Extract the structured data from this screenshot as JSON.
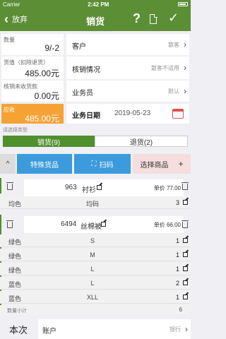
{
  "status": {
    "carrier": "Carrier",
    "time": "2:42 PM"
  },
  "nav": {
    "back_label": "放弃",
    "title": "销货",
    "help": "?",
    "confirm": "✓"
  },
  "left": {
    "quantity_label": "数量",
    "quantity_value": "9/-2",
    "goods_label": "货值（扣除退货）",
    "goods_value": "485.00元",
    "unsettled_label": "核销未收货款",
    "unsettled_value": "0.00元",
    "receivable_label": "应收",
    "receivable_value": "485.00元"
  },
  "right": {
    "customer_label": "客户",
    "customer_hint": "散客",
    "settle_label": "核销情况",
    "settle_hint": "散客不适用",
    "staff_label": "业务员",
    "staff_hint": "默认",
    "date_label": "业务日期",
    "date_value": "2019-05-23"
  },
  "type_section_label": "请选择类型",
  "tabs": {
    "sales": "销货(9)",
    "returns": "退货(2)"
  },
  "tools": {
    "collapse": "^",
    "special": "特殊货品",
    "scan": "扫码",
    "select": "选择商品",
    "add": "+"
  },
  "items": [
    {
      "code": "963",
      "name": "衬衫",
      "unit_price": "单价 77.00",
      "rows": [
        {
          "color": "均色",
          "size": "均码",
          "qty": "3"
        }
      ]
    },
    {
      "code": "6494",
      "name": "丝棉被",
      "unit_price": "单价 66.00",
      "rows": [
        {
          "color": "绿色",
          "size": "S",
          "qty": "1"
        },
        {
          "color": "绿色",
          "size": "M",
          "qty": "1"
        },
        {
          "color": "绿色",
          "size": "L",
          "qty": "1"
        },
        {
          "color": "蓝色",
          "size": "L",
          "qty": "2"
        },
        {
          "color": "蓝色",
          "size": "XLL",
          "qty": "1"
        }
      ]
    }
  ],
  "subtotal": {
    "label": "数量小计",
    "value": "6"
  },
  "bottom": {
    "tab_label": "本次",
    "account_label": "账户",
    "account_hint": "银行"
  }
}
